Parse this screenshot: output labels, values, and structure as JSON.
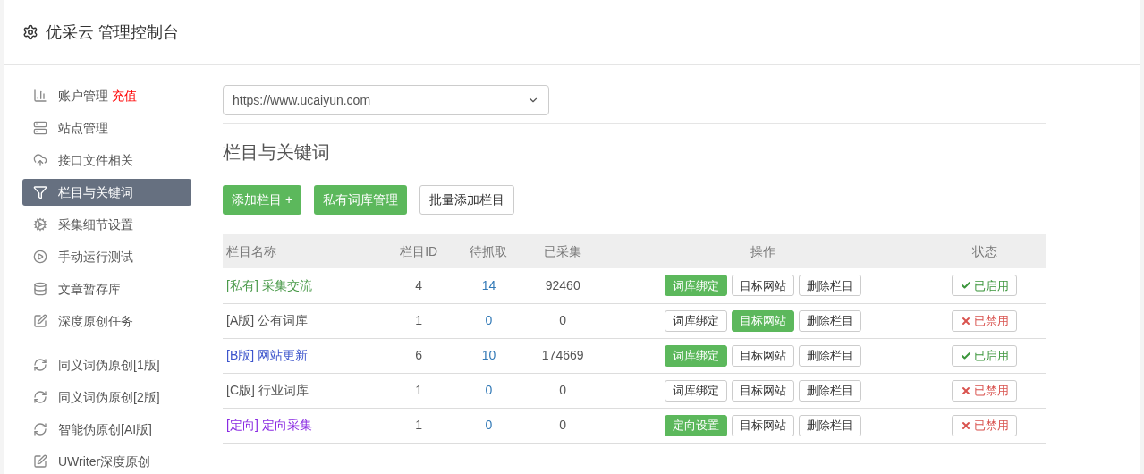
{
  "header": {
    "title": "优采云 管理控制台"
  },
  "sidebar": {
    "items": [
      {
        "kind": "chart",
        "label": "账户管理",
        "badge": "充值",
        "selected": false
      },
      {
        "kind": "server",
        "label": "站点管理",
        "selected": false
      },
      {
        "kind": "cloud",
        "label": "接口文件相关",
        "selected": false
      },
      {
        "kind": "filter",
        "label": "栏目与关键词",
        "selected": true
      },
      {
        "kind": "gears",
        "label": "采集细节设置",
        "selected": false
      },
      {
        "kind": "play",
        "label": "手动运行测试",
        "selected": false
      },
      {
        "kind": "database",
        "label": "文章暂存库",
        "selected": false
      },
      {
        "kind": "edit",
        "label": "深度原创任务",
        "selected": false
      },
      {
        "kind": "divider"
      },
      {
        "kind": "refresh",
        "label": "同义词伪原创[1版]",
        "selected": false
      },
      {
        "kind": "refresh",
        "label": "同义词伪原创[2版]",
        "selected": false
      },
      {
        "kind": "refresh",
        "label": "智能伪原创[AI版]",
        "selected": false
      },
      {
        "kind": "edit",
        "label": "UWriter深度原创",
        "selected": false
      }
    ]
  },
  "site_select": {
    "value": "https://www.ucaiyun.com"
  },
  "section_title": "栏目与关键词",
  "toolbar": [
    {
      "label": "添加栏目 +",
      "primary": true
    },
    {
      "label": "私有词库管理",
      "primary": true
    },
    {
      "label": "批量添加栏目",
      "primary": false
    }
  ],
  "table": {
    "columns": [
      "栏目名称",
      "栏目ID",
      "待抓取",
      "已采集",
      "操作",
      "状态"
    ],
    "rows": [
      {
        "name": "[私有] 采集交流",
        "color": "#4a9a4a",
        "id": "4",
        "pending": "14",
        "collected": "92460",
        "actions": [
          {
            "label": "词库绑定",
            "selected": true
          },
          {
            "label": "目标网站",
            "selected": false
          },
          {
            "label": "删除栏目",
            "selected": false
          }
        ],
        "status": {
          "label": "已启用",
          "on": true
        }
      },
      {
        "name": "[A版] 公有词库",
        "color": "#555555",
        "id": "1",
        "pending": "0",
        "collected": "0",
        "actions": [
          {
            "label": "词库绑定",
            "selected": false
          },
          {
            "label": "目标网站",
            "selected": true
          },
          {
            "label": "删除栏目",
            "selected": false
          }
        ],
        "status": {
          "label": "已禁用",
          "on": false
        }
      },
      {
        "name": "[B版] 网站更新",
        "color": "#3d55cc",
        "id": "6",
        "pending": "10",
        "collected": "174669",
        "actions": [
          {
            "label": "词库绑定",
            "selected": true
          },
          {
            "label": "目标网站",
            "selected": false
          },
          {
            "label": "删除栏目",
            "selected": false
          }
        ],
        "status": {
          "label": "已启用",
          "on": true
        }
      },
      {
        "name": "[C版] 行业词库",
        "color": "#555555",
        "id": "1",
        "pending": "0",
        "collected": "0",
        "actions": [
          {
            "label": "词库绑定",
            "selected": false
          },
          {
            "label": "目标网站",
            "selected": false
          },
          {
            "label": "删除栏目",
            "selected": false
          }
        ],
        "status": {
          "label": "已禁用",
          "on": false
        }
      },
      {
        "name": "[定向] 定向采集",
        "color": "#8a2be2",
        "id": "1",
        "pending": "0",
        "collected": "0",
        "actions": [
          {
            "label": "定向设置",
            "selected": true
          },
          {
            "label": "目标网站",
            "selected": false
          },
          {
            "label": "删除栏目",
            "selected": false
          }
        ],
        "status": {
          "label": "已禁用",
          "on": false
        }
      }
    ]
  }
}
